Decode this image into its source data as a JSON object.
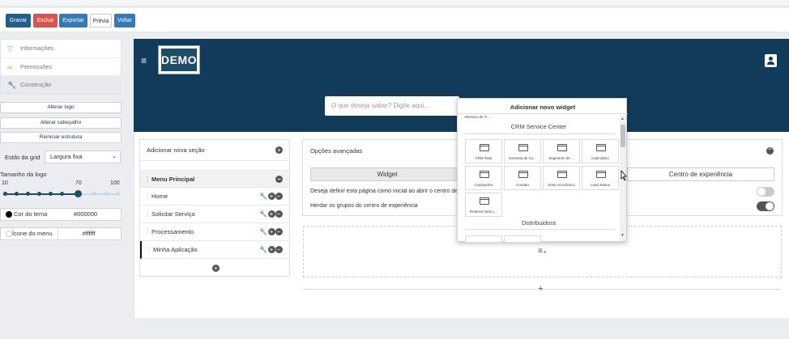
{
  "toolbar": {
    "buttons": [
      {
        "label": "Gravar",
        "color": "#1f5f8b"
      },
      {
        "label": "Excluir",
        "color": "#d9534f"
      },
      {
        "label": "Exportar",
        "color": "#337ab7"
      },
      {
        "label": "Prévia",
        "color": "#ffffff"
      },
      {
        "label": "Voltar",
        "color": "#337ab7"
      }
    ]
  },
  "sidebar": {
    "menu": [
      {
        "label": "Informações",
        "icon": "funnel-icon"
      },
      {
        "label": "Permissões",
        "icon": "link-icon"
      },
      {
        "label": "Construção",
        "icon": "wrench-icon"
      }
    ],
    "actions": [
      "Alterar logo",
      "Alterar cabeçalho",
      "Reiniciar estrutura"
    ],
    "grid_style": {
      "label": "Estilo da grid",
      "value": "Largura fixa"
    },
    "logo_size": {
      "label": "Tamanho da logo",
      "min": "10",
      "value": "70",
      "max": "100"
    },
    "theme_color": {
      "label": "Cor do tema",
      "value": "#000000"
    },
    "menu_icon": {
      "label": "Ícone do menu",
      "value": "#ffffff"
    }
  },
  "header": {
    "logo_text": "DEMO",
    "search_placeholder": "O que deseja saber? Digite aqui...",
    "banner_color": "#123a5a"
  },
  "sections": {
    "add_label": "Adicionar nova seção",
    "menu_title": "Menu Principal",
    "items": [
      "Home",
      "Solicitar Serviço",
      "Processamento",
      "Minha Aplicação"
    ]
  },
  "advanced": {
    "title": "Opções avançadas",
    "tab_widget": "Widget",
    "tab_experience": "Centro de experiência",
    "option1": "Deseja definir esta página como inicial ao abrir o centro de",
    "option2": "Herdar os grupos do centro de experiência"
  },
  "popup": {
    "title": "Adicionar novo widget",
    "top_partial": "Abertura de Ti...",
    "group1": "CRM Service Center",
    "widgets": [
      "CRM Task",
      "Garantia de Co...",
      "Segmento de ...",
      "Calendário",
      "Campanha",
      "Contato",
      "Setor econômico",
      "Lead Status",
      "Redirect New L..."
    ],
    "group2": "Distribuidora"
  }
}
